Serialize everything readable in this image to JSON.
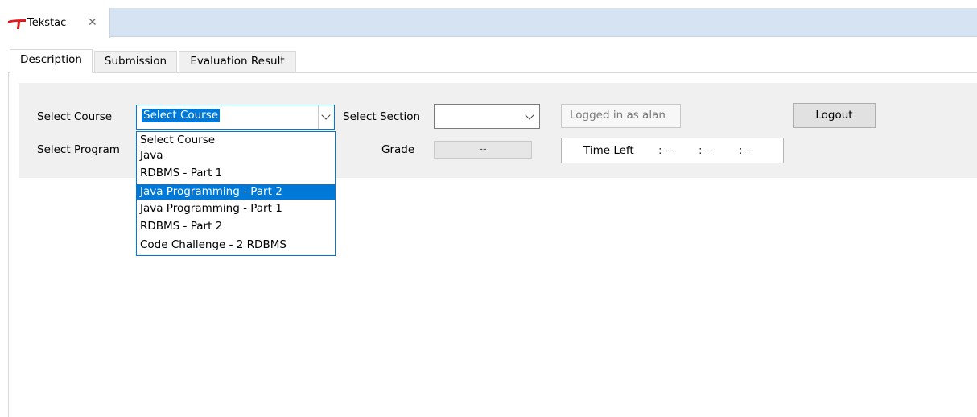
{
  "editor_tab": {
    "title": "Tekstac",
    "close_glyph": "✕"
  },
  "sub_tabs": [
    {
      "label": "Description",
      "active": true
    },
    {
      "label": "Submission",
      "active": false
    },
    {
      "label": "Evaluation Result",
      "active": false
    }
  ],
  "form": {
    "select_course_label": "Select Course",
    "select_course_value": "Select Course",
    "select_section_label": "Select Section",
    "select_section_value": "",
    "logged_in_text": "Logged in as alan",
    "logout_label": "Logout",
    "select_program_label": "Select Program",
    "grade_label": "Grade",
    "grade_value": "--",
    "time_left_label": "Time Left",
    "time_parts": [
      ": --",
      ": --",
      ": --"
    ]
  },
  "course_dropdown": {
    "options": [
      "Select Course",
      "Java",
      "RDBMS - Part 1",
      "Java Programming - Part 2",
      "Java Programming - Part 1",
      "RDBMS - Part 2",
      "Code Challenge - 2 RDBMS"
    ],
    "highlighted_index": 3
  },
  "colors": {
    "accent": "#0078d7",
    "tabbar": "#d6e3f2",
    "panel": "#f0f0f0",
    "logo_red": "#e3151a"
  },
  "icons": [
    "tekstac-logo-icon",
    "close-icon",
    "chevron-down-icon"
  ]
}
